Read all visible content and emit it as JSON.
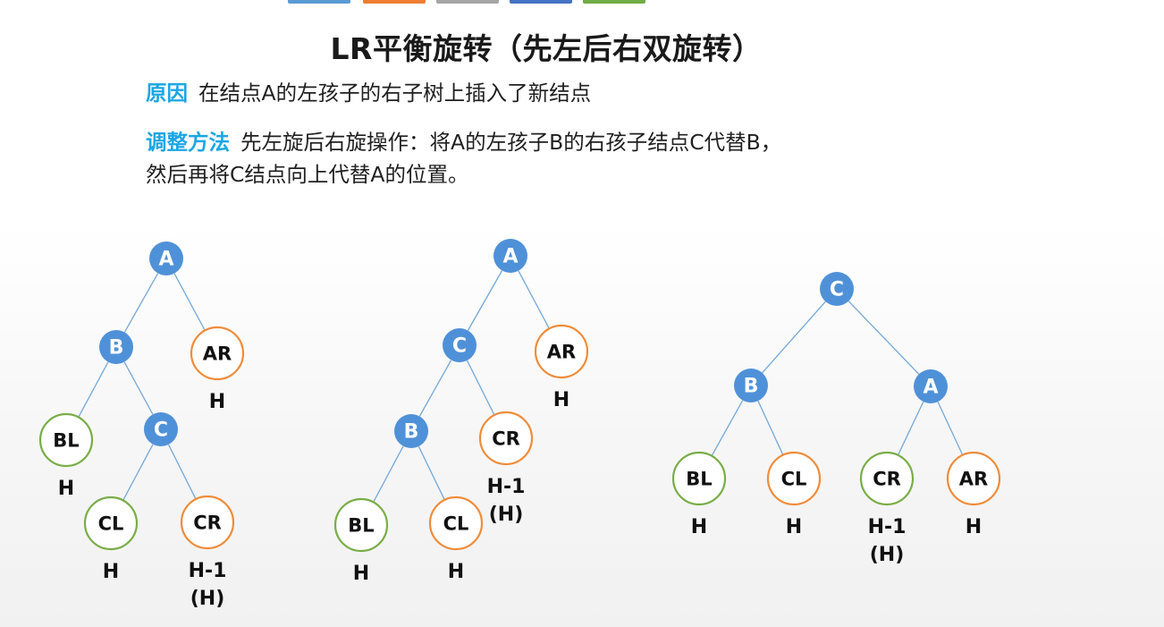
{
  "title": "LR平衡旋转（先左后右双旋转）",
  "reason": {
    "keyword": "原因",
    "text": "在结点A的左孩子的右子树上插入了新结点"
  },
  "method": {
    "keyword": "调整方法",
    "text_line1": "先左旋后右旋操作：将A的左孩子B的右孩子结点C代替B，",
    "text_line2": "然后再将C结点向上代替A的位置。"
  },
  "colors": {
    "keyword": "#1ca6e3",
    "filled_node": "#4f91d8",
    "green_node": "#78ad47",
    "orange_node": "#ef8c3a",
    "edge": "#74a8d8",
    "top_bars": [
      "#5b9bd5",
      "#ed7d31",
      "#a5a5a5",
      "#4472c4",
      "#70ad47"
    ]
  },
  "trees": [
    {
      "name": "before-rotation",
      "nodes": [
        {
          "id": "A",
          "label": "A",
          "style": "filled"
        },
        {
          "id": "B",
          "label": "B",
          "style": "filled"
        },
        {
          "id": "AR",
          "label": "AR",
          "style": "orange",
          "height": "H"
        },
        {
          "id": "BL",
          "label": "BL",
          "style": "green",
          "height": "H"
        },
        {
          "id": "C",
          "label": "C",
          "style": "filled"
        },
        {
          "id": "CL",
          "label": "CL",
          "style": "green",
          "height": "H"
        },
        {
          "id": "CR",
          "label": "CR",
          "style": "orange",
          "height": "H-1",
          "height_alt": "(H)"
        }
      ],
      "edges": [
        [
          "A",
          "B"
        ],
        [
          "A",
          "AR"
        ],
        [
          "B",
          "BL"
        ],
        [
          "B",
          "C"
        ],
        [
          "C",
          "CL"
        ],
        [
          "C",
          "CR"
        ]
      ]
    },
    {
      "name": "after-left-rotation",
      "nodes": [
        {
          "id": "A",
          "label": "A",
          "style": "filled"
        },
        {
          "id": "C",
          "label": "C",
          "style": "filled"
        },
        {
          "id": "AR",
          "label": "AR",
          "style": "orange",
          "height": "H"
        },
        {
          "id": "B",
          "label": "B",
          "style": "filled"
        },
        {
          "id": "CR",
          "label": "CR",
          "style": "orange",
          "height": "H-1",
          "height_alt": "(H)"
        },
        {
          "id": "BL",
          "label": "BL",
          "style": "green",
          "height": "H"
        },
        {
          "id": "CL",
          "label": "CL",
          "style": "orange",
          "height": "H"
        }
      ],
      "edges": [
        [
          "A",
          "C"
        ],
        [
          "A",
          "AR"
        ],
        [
          "C",
          "B"
        ],
        [
          "C",
          "CR"
        ],
        [
          "B",
          "BL"
        ],
        [
          "B",
          "CL"
        ]
      ]
    },
    {
      "name": "after-right-rotation",
      "nodes": [
        {
          "id": "C",
          "label": "C",
          "style": "filled"
        },
        {
          "id": "B",
          "label": "B",
          "style": "filled"
        },
        {
          "id": "A",
          "label": "A",
          "style": "filled"
        },
        {
          "id": "BL",
          "label": "BL",
          "style": "green",
          "height": "H"
        },
        {
          "id": "CL",
          "label": "CL",
          "style": "orange",
          "height": "H"
        },
        {
          "id": "CR",
          "label": "CR",
          "style": "green",
          "height": "H-1",
          "height_alt": "(H)"
        },
        {
          "id": "AR",
          "label": "AR",
          "style": "orange",
          "height": "H"
        }
      ],
      "edges": [
        [
          "C",
          "B"
        ],
        [
          "C",
          "A"
        ],
        [
          "B",
          "BL"
        ],
        [
          "B",
          "CL"
        ],
        [
          "A",
          "CR"
        ],
        [
          "A",
          "AR"
        ]
      ]
    }
  ]
}
